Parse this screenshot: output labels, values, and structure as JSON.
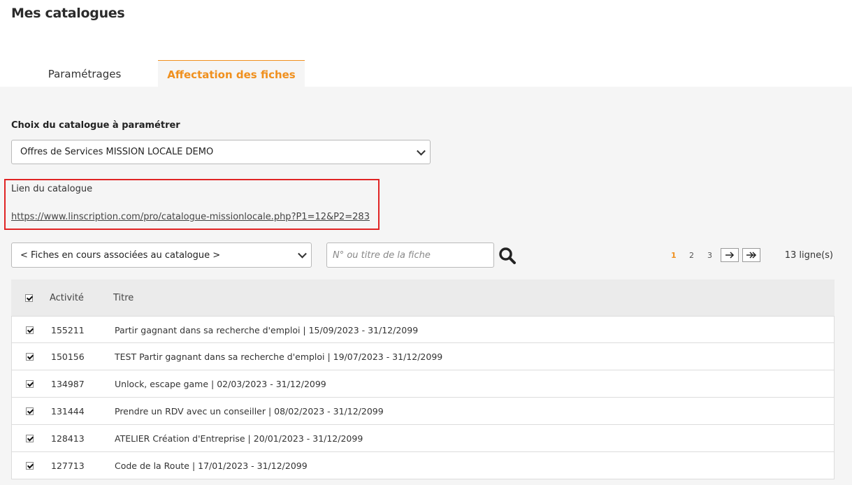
{
  "page": {
    "title": "Mes catalogues"
  },
  "tabs": [
    {
      "label": "Paramétrages",
      "active": false
    },
    {
      "label": "Affectation des fiches",
      "active": true
    }
  ],
  "catalogue": {
    "label": "Choix du catalogue à paramétrer",
    "selected": "Offres de Services MISSION LOCALE DEMO"
  },
  "link": {
    "label": "Lien du catalogue",
    "url": "https://www.linscription.com/pro/catalogue-missionlocale.php?P1=12&P2=283"
  },
  "filter": {
    "selected": "< Fiches en cours associées au catalogue >",
    "search_placeholder": "N° ou titre de la fiche"
  },
  "pagination": {
    "pages": [
      "1",
      "2",
      "3"
    ],
    "current": "1",
    "count": "13 ligne(s)"
  },
  "table": {
    "headers": {
      "activity": "Activité",
      "title": "Titre"
    },
    "rows": [
      {
        "id": "155211",
        "title": "Partir gagnant dans sa recherche d'emploi | 15/09/2023 - 31/12/2099",
        "checked": true
      },
      {
        "id": "150156",
        "title": "TEST Partir gagnant dans sa recherche d'emploi | 19/07/2023 - 31/12/2099",
        "checked": true
      },
      {
        "id": "134987",
        "title": "Unlock, escape game | 02/03/2023 - 31/12/2099",
        "checked": true
      },
      {
        "id": "131444",
        "title": "Prendre un RDV avec un conseiller | 08/02/2023 - 31/12/2099",
        "checked": true
      },
      {
        "id": "128413",
        "title": "ATELIER Création d'Entreprise | 20/01/2023 - 31/12/2099",
        "checked": true
      },
      {
        "id": "127713",
        "title": "Code de la Route | 17/01/2023 - 31/12/2099",
        "checked": true
      }
    ]
  },
  "colors": {
    "accent": "#f0901e",
    "highlight_border": "#e02424",
    "panel_bg": "#f5f5f5"
  }
}
